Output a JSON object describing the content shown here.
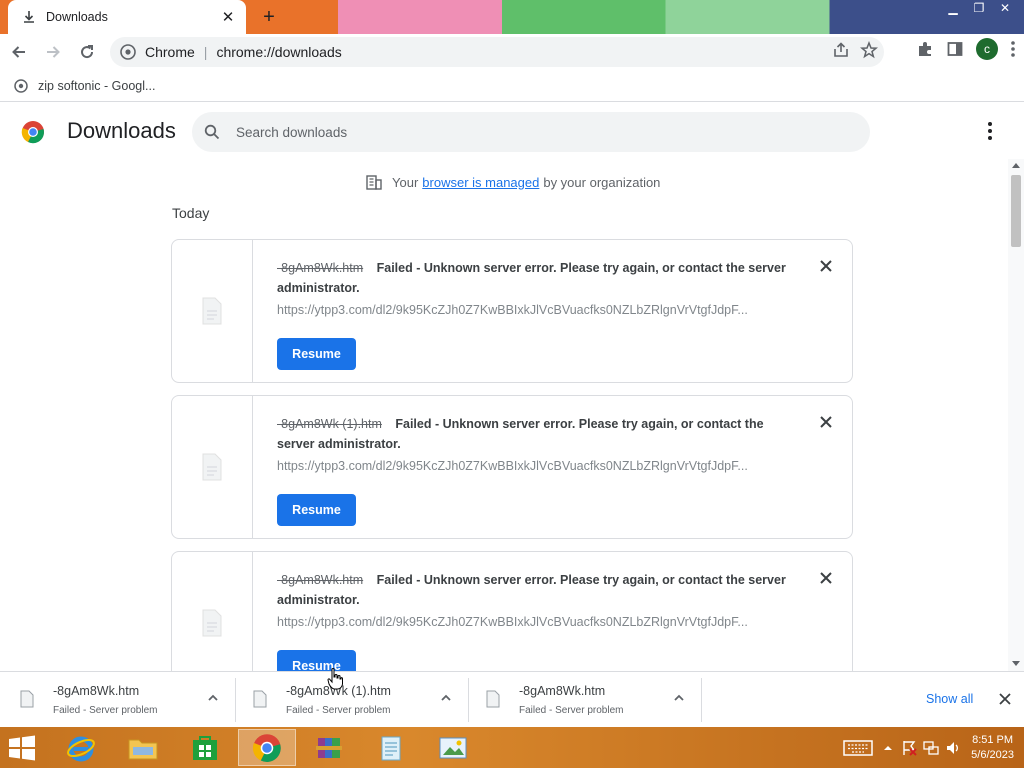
{
  "window": {
    "tab_title": "Downloads",
    "tab_close": "✕",
    "new_tab": "+"
  },
  "toolbar": {
    "site_label": "Chrome",
    "separator": "|",
    "url": "chrome://downloads",
    "avatar_letter": "c"
  },
  "bookmarks": [
    {
      "label": "zip softonic - Googl..."
    }
  ],
  "page": {
    "title": "Downloads",
    "search_placeholder": "Search downloads",
    "managed_prefix": "Your",
    "managed_link": "browser is managed",
    "managed_suffix": "by your organization",
    "section_label": "Today"
  },
  "downloads": [
    {
      "filename": "-8gAm8Wk.htm",
      "status": "Failed - Unknown server error. Please try again, or contact the server administrator.",
      "url": "https://ytpp3.com/dl2/9k95KcZJh0Z7KwBBIxkJlVcBVuacfks0NZLbZRlgnVrVtgfJdpF...",
      "action": "Resume"
    },
    {
      "filename": "-8gAm8Wk (1).htm",
      "status": "Failed - Unknown server error. Please try again, or contact the server administrator.",
      "url": "https://ytpp3.com/dl2/9k95KcZJh0Z7KwBBIxkJlVcBVuacfks0NZLbZRlgnVrVtgfJdpF...",
      "action": "Resume"
    },
    {
      "filename": "-8gAm8Wk.htm",
      "status": "Failed - Unknown server error. Please try again, or contact the server administrator.",
      "url": "https://ytpp3.com/dl2/9k95KcZJh0Z7KwBBIxkJlVcBVuacfks0NZLbZRlgnVrVtgfJdpF...",
      "action": "Resume"
    }
  ],
  "shelf": {
    "items": [
      {
        "name": "-8gAm8Wk.htm",
        "status": "Failed - Server problem"
      },
      {
        "name": "-8gAm8Wk (1).htm",
        "status": "Failed - Server problem"
      },
      {
        "name": "-8gAm8Wk.htm",
        "status": "Failed - Server problem"
      }
    ],
    "show_all": "Show all"
  },
  "taskbar": {
    "time": "8:51 PM",
    "date": "5/6/2023",
    "apps": [
      "internet-explorer",
      "file-explorer",
      "store",
      "chrome",
      "winrar",
      "notepad",
      "photo-viewer"
    ]
  },
  "colors": {
    "accent": "#1a73e8",
    "taskbar": "#d9882c"
  }
}
